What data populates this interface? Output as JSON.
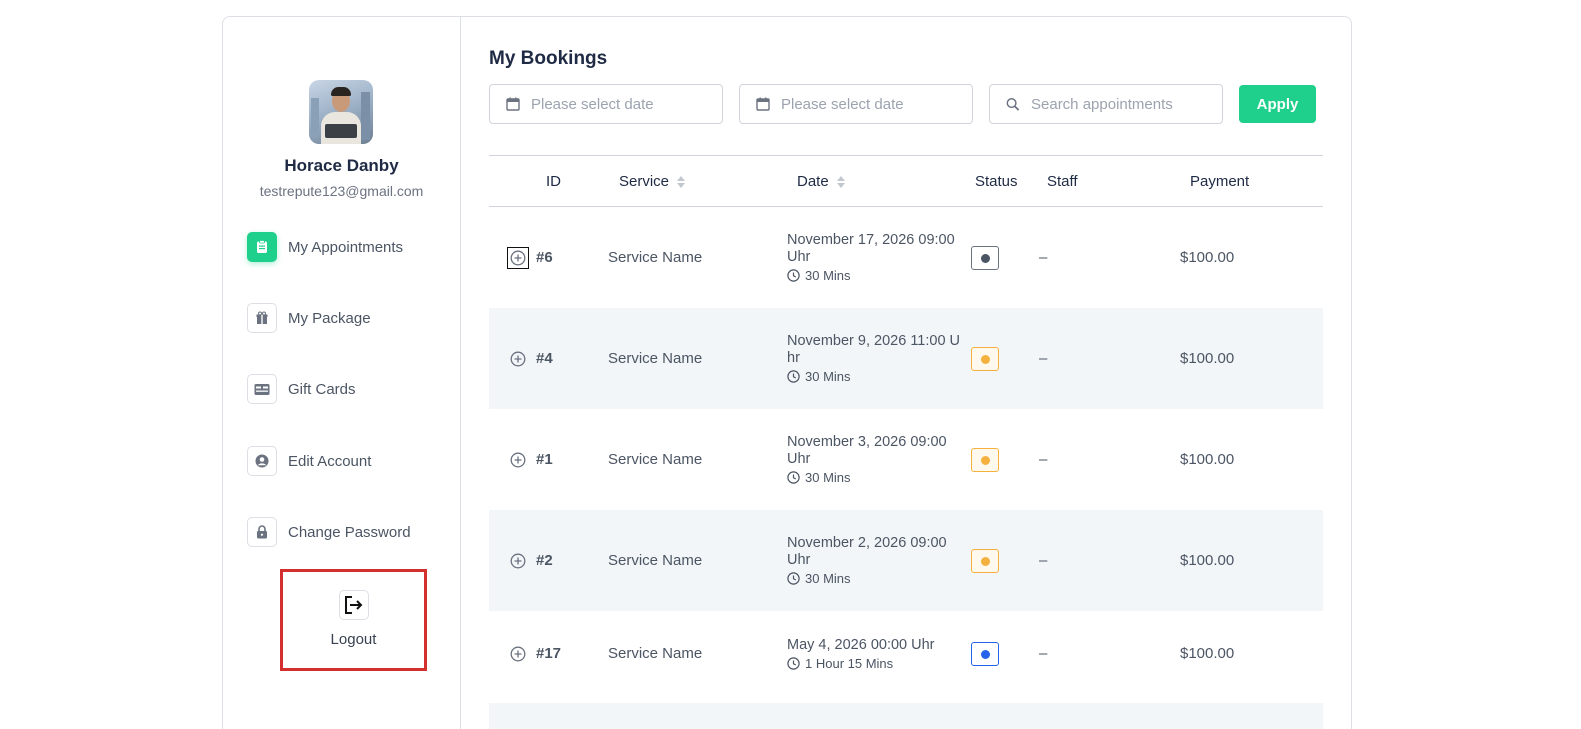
{
  "sidebar": {
    "user_name": "Horace Danby",
    "user_email": "testrepute123@gmail.com",
    "items": [
      {
        "label": "My Appointments",
        "icon": "clipboard-icon",
        "active": true
      },
      {
        "label": "My Package",
        "icon": "gift-icon",
        "active": false
      },
      {
        "label": "Gift Cards",
        "icon": "card-icon",
        "active": false
      },
      {
        "label": "Edit Account",
        "icon": "user-circle-icon",
        "active": false
      },
      {
        "label": "Change Password",
        "icon": "lock-icon",
        "active": false
      }
    ],
    "logout_label": "Logout"
  },
  "main": {
    "title": "My Bookings",
    "filters": {
      "start_date_placeholder": "Please select date",
      "end_date_placeholder": "Please select date",
      "search_placeholder": "Search appointments",
      "apply_label": "Apply"
    },
    "columns": [
      "ID",
      "Service",
      "Date",
      "Status",
      "Staff",
      "Payment"
    ],
    "rows": [
      {
        "id": "#6",
        "service": "Service Name",
        "date_line1": "November 17, 2026 09:00",
        "date_line2": "Uhr",
        "duration": "30 Mins",
        "status_color": "#4b5563",
        "status_border": "#6b7280",
        "staff": "–",
        "payment": "$100.00"
      },
      {
        "id": "#4",
        "service": "Service Name",
        "date_line1": "November 9, 2026 11:00 U",
        "date_line2": "hr",
        "duration": "30 Mins",
        "status_color": "#f5b13d",
        "status_border": "#f5b13d",
        "staff": "–",
        "payment": "$100.00"
      },
      {
        "id": "#1",
        "service": "Service Name",
        "date_line1": "November 3, 2026 09:00",
        "date_line2": "Uhr",
        "duration": "30 Mins",
        "status_color": "#f5b13d",
        "status_border": "#f5b13d",
        "staff": "–",
        "payment": "$100.00"
      },
      {
        "id": "#2",
        "service": "Service Name",
        "date_line1": "November 2, 2026 09:00",
        "date_line2": "Uhr",
        "duration": "30 Mins",
        "status_color": "#f5b13d",
        "status_border": "#f5b13d",
        "staff": "–",
        "payment": "$100.00"
      },
      {
        "id": "#17",
        "service": "Service Name",
        "date_line1": "May 4, 2026 00:00 Uhr",
        "date_line2": "",
        "duration": "1 Hour 15 Mins",
        "status_color": "#2563eb",
        "status_border": "#2563eb",
        "staff": "–",
        "payment": "$100.00"
      }
    ]
  },
  "colors": {
    "accent": "#1fcf8c",
    "highlight_border": "#d32f2f",
    "row_alt": "#f3f6f9"
  }
}
